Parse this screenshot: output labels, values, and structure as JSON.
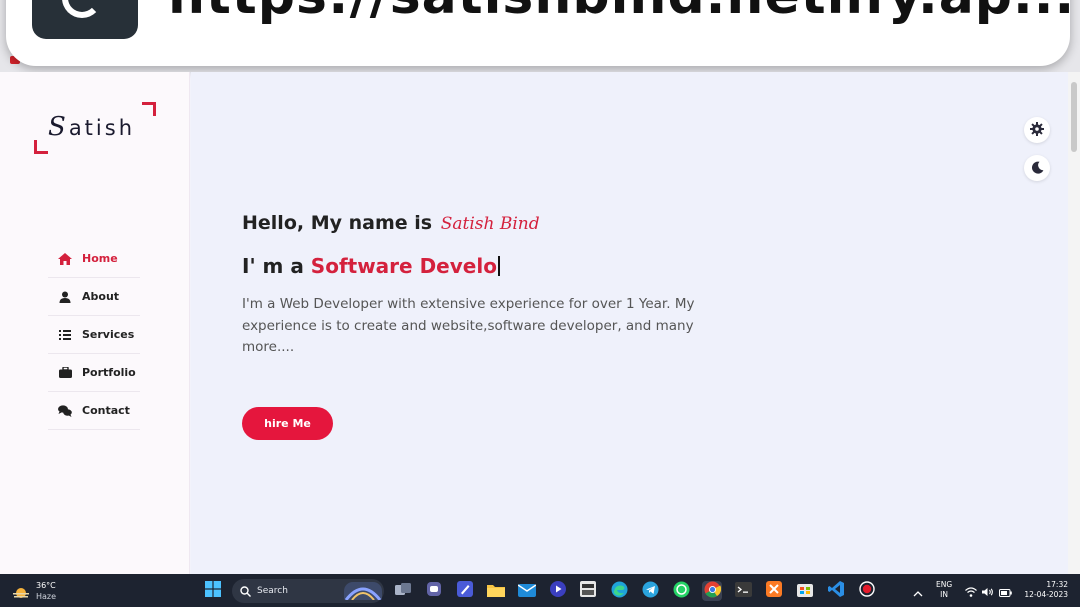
{
  "browser": {
    "url_popup_text": "https://satishbind.netlify.ap..."
  },
  "sidebar": {
    "logo": {
      "initial": "S",
      "rest": "atish"
    },
    "items": [
      {
        "label": "Home",
        "icon": "home-icon",
        "active": true
      },
      {
        "label": "About",
        "icon": "user-icon",
        "active": false
      },
      {
        "label": "Services",
        "icon": "list-icon",
        "active": false
      },
      {
        "label": "Portfolio",
        "icon": "briefcase-icon",
        "active": false
      },
      {
        "label": "Contact",
        "icon": "comments-icon",
        "active": false
      }
    ]
  },
  "hero": {
    "greeting": "Hello, My name is",
    "name_script": "Satish Bind",
    "role_prefix": "I' m a",
    "role_typed": "Software Develo",
    "description": "I'm a Web Developer with extensive experience for over 1 Year. My experience is to create and website,software developer, and many more....",
    "cta_label": "hire Me"
  },
  "controls": {
    "settings_icon": "gear-icon",
    "theme_icon": "moon-icon"
  },
  "taskbar": {
    "weather": {
      "temp": "36°C",
      "condition": "Haze"
    },
    "search_label": "Search",
    "language": {
      "line1": "ENG",
      "line2": "IN"
    },
    "time": "17:32",
    "date": "12-04-2023"
  },
  "colors": {
    "accent": "#e5163d",
    "main_bg": "#eff1fb",
    "sidebar_bg": "#fcf9fc",
    "taskbar_bg": "#1d2330"
  }
}
